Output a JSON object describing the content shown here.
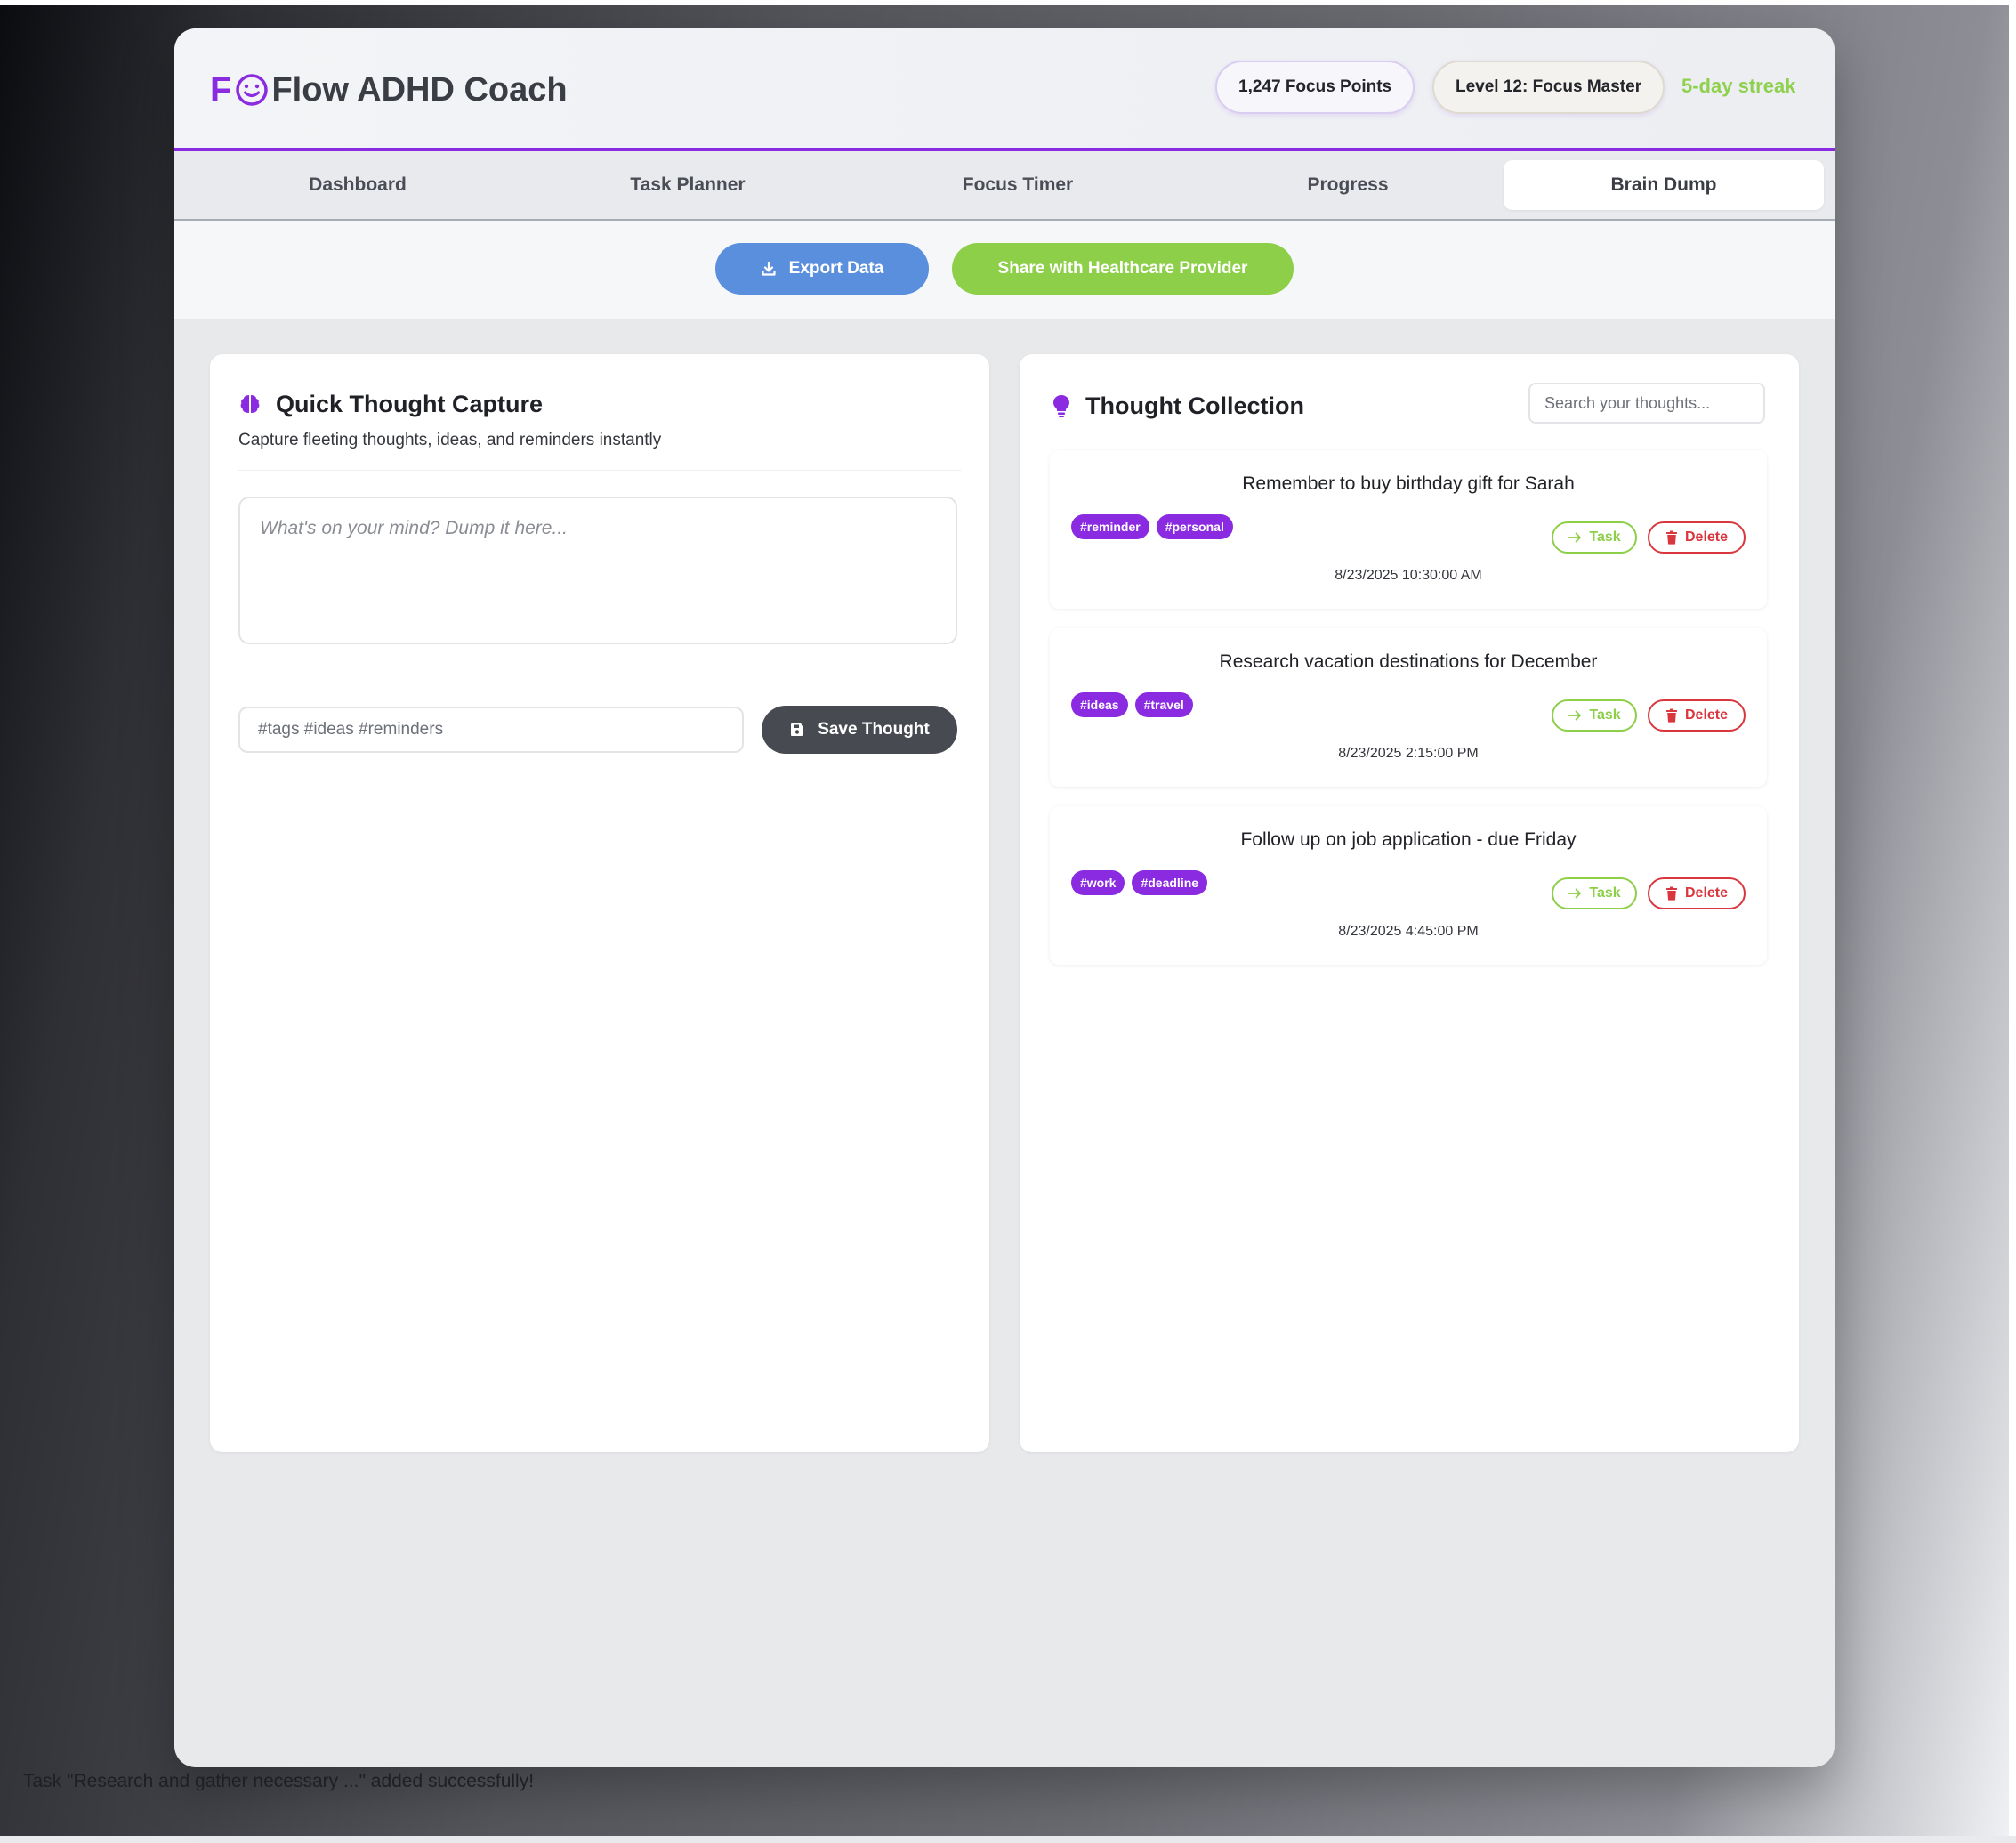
{
  "app": {
    "logo_letter": "F",
    "title": "Flow ADHD Coach",
    "focus_points": "1,247 Focus Points",
    "level": "Level 12: Focus Master",
    "streak": "5-day streak",
    "accent_color": "#8a2be2"
  },
  "nav": {
    "tabs": [
      {
        "label": "Dashboard",
        "active": false
      },
      {
        "label": "Task Planner",
        "active": false
      },
      {
        "label": "Focus Timer",
        "active": false
      },
      {
        "label": "Progress",
        "active": false
      },
      {
        "label": "Brain Dump",
        "active": true
      }
    ]
  },
  "actions": {
    "export_label": "Export Data",
    "share_label": "Share with Healthcare Provider"
  },
  "capture": {
    "icon": "brain-icon",
    "title": "Quick Thought Capture",
    "subtitle": "Capture fleeting thoughts, ideas, and reminders instantly",
    "textarea_placeholder": "What's on your mind? Dump it here...",
    "tags_placeholder": "#tags #ideas #reminders",
    "save_label": "Save Thought"
  },
  "collection": {
    "icon": "lightbulb-icon",
    "title": "Thought Collection",
    "search_placeholder": "Search your thoughts...",
    "task_label": "Task",
    "delete_label": "Delete",
    "thoughts": [
      {
        "text": "Remember to buy birthday gift for Sarah",
        "tags": [
          "#reminder",
          "#personal"
        ],
        "timestamp": "8/23/2025 10:30:00 AM"
      },
      {
        "text": "Research vacation destinations for December",
        "tags": [
          "#ideas",
          "#travel"
        ],
        "timestamp": "8/23/2025 2:15:00 PM"
      },
      {
        "text": "Follow up on job application - due Friday",
        "tags": [
          "#work",
          "#deadline"
        ],
        "timestamp": "8/23/2025 4:45:00 PM"
      }
    ]
  },
  "toast": {
    "message": "Task \"Research and gather necessary ...\" added successfully!"
  }
}
